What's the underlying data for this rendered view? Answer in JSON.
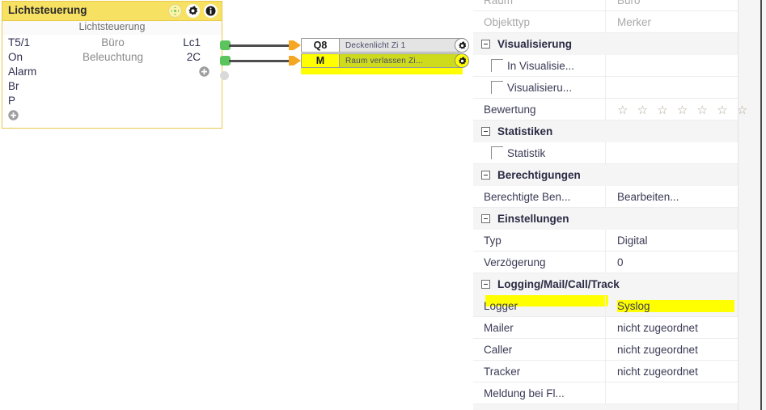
{
  "block": {
    "title": "Lichtsteuerung",
    "subtitle": "Lichtsteuerung",
    "title_icons": [
      {
        "name": "move-icon",
        "glyph": "move"
      },
      {
        "name": "gear-icon",
        "glyph": "gear"
      },
      {
        "name": "info-icon",
        "glyph": "info"
      }
    ],
    "inputs": [
      "T5/1",
      "On",
      "Alarm",
      "Br",
      "P"
    ],
    "middle": [
      "Büro",
      "Beleuchtung"
    ],
    "outputs": [
      "Lc1",
      "2C"
    ],
    "add_input_label": "+",
    "add_output_label": "+"
  },
  "connectors": [
    {
      "key": "Q8",
      "label": "Deckenlicht Zi 1",
      "key_highlighted": false,
      "label_highlighted": false,
      "gear_icon": "gear-icon"
    },
    {
      "key": "M",
      "label": "Raum  verlassen Zi...",
      "key_highlighted": true,
      "label_highlighted": true,
      "gear_icon": "gear-icon"
    }
  ],
  "properties": {
    "rows": [
      {
        "type": "item",
        "name": "Raum",
        "value": "Büro",
        "dim": true,
        "clipped_top": true
      },
      {
        "type": "item",
        "name": "Objekttyp",
        "value": "Merker",
        "dim": true
      },
      {
        "type": "group",
        "name": "Visualisierung",
        "expander": "minus"
      },
      {
        "type": "check",
        "name": "In Visualisie...",
        "value": ""
      },
      {
        "type": "check",
        "name": "Visualisieru...",
        "value": ""
      },
      {
        "type": "stars",
        "name": "Bewertung",
        "value": "☆ ☆ ☆ ☆ ☆ ☆ ☆",
        "stars": 6.5
      },
      {
        "type": "group",
        "name": "Statistiken",
        "expander": "minus"
      },
      {
        "type": "check",
        "name": "Statistik",
        "value": ""
      },
      {
        "type": "group",
        "name": "Berechtigungen",
        "expander": "minus"
      },
      {
        "type": "item",
        "name": "Berechtigte Ben...",
        "value": "Bearbeiten..."
      },
      {
        "type": "group",
        "name": "Einstellungen",
        "expander": "minus"
      },
      {
        "type": "item",
        "name": "Typ",
        "value": "Digital"
      },
      {
        "type": "item",
        "name": "Verzögerung",
        "value": "0"
      },
      {
        "type": "group",
        "name": "Logging/Mail/Call/Track",
        "expander": "minus"
      },
      {
        "type": "item",
        "name": "Logger",
        "value": "Syslog",
        "value_highlighted": true
      },
      {
        "type": "item",
        "name": "Mailer",
        "value": "nicht zugeordnet"
      },
      {
        "type": "item",
        "name": "Caller",
        "value": "nicht zugeordnet"
      },
      {
        "type": "item",
        "name": "Tracker",
        "value": "nicht zugeordnet"
      },
      {
        "type": "item",
        "name": "Meldung bei Fl...",
        "value": "",
        "clipped_bottom": true
      }
    ]
  },
  "colors": {
    "block_title_bg": "#f7e163",
    "block_border": "#e8c84a",
    "highlight_yellow": "#ffff00",
    "marker_green": "#cddb1c",
    "port_green": "#5cc45c",
    "arrow_orange": "#f5a623",
    "wire": "#4d4d4d"
  }
}
